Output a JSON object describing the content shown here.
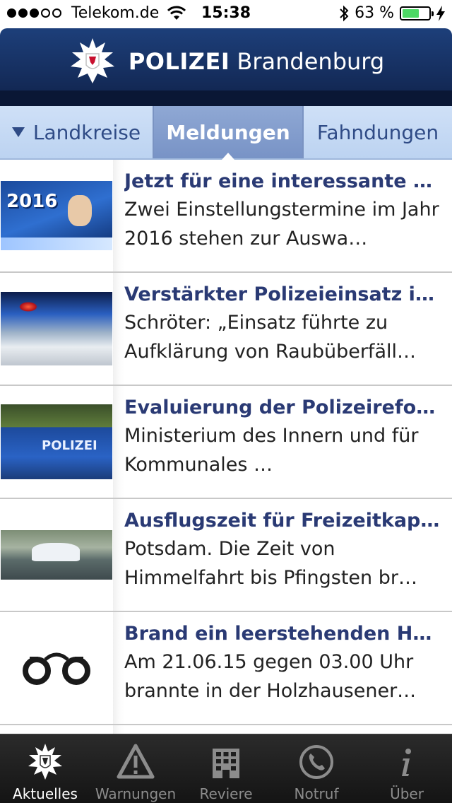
{
  "status_bar": {
    "signal": [
      true,
      true,
      true,
      false,
      false
    ],
    "carrier": "Telekom.de",
    "time": "15:38",
    "battery_text": "63 %",
    "battery_level": 0.63,
    "icons": [
      "wifi-icon",
      "bluetooth-icon",
      "battery-icon",
      "charging-bolt-icon"
    ]
  },
  "header": {
    "logo": "brandenburg-police-star-icon",
    "title_bold": "POLIZEI",
    "title_regular": " Brandenburg"
  },
  "tabs": {
    "landkreise": "Landkreise",
    "meldungen": "Meldungen",
    "fahndungen": "Fahndungen",
    "active": "meldungen"
  },
  "news": [
    {
      "title": "Jetzt für eine interessante un…",
      "desc": "Zwei Einstellungstermine im Jahr 2016 stehen zur Auswa…",
      "thumb_text": "2016"
    },
    {
      "title": "Verstärkter Polizeieinsatz in…",
      "desc": "Schröter: „Einsatz führte zu Aufklärung von Raubüberfäll…"
    },
    {
      "title": "Evaluierung der Polizeirefor…",
      "desc": "Ministerium des Innern und für Kommunales …",
      "thumb_text": "POLIZEI"
    },
    {
      "title": "Ausflugszeit für Freizeitkapit…",
      "desc": "Potsdam. Die Zeit von Himmelfahrt bis Pfingsten br…"
    },
    {
      "title": "Brand ein leerstehenden Hau…",
      "desc": "Am 21.06.15 gegen 03.00 Uhr brannte in der Holzhausener…",
      "icon": "handcuffs-icon"
    }
  ],
  "tabbar": {
    "items": [
      {
        "label": "Aktuelles",
        "icon": "police-star-icon",
        "active": true
      },
      {
        "label": "Warnungen",
        "icon": "warning-icon",
        "active": false
      },
      {
        "label": "Reviere",
        "icon": "building-icon",
        "active": false
      },
      {
        "label": "Notruf",
        "icon": "phone-icon",
        "active": false
      },
      {
        "label": "Über",
        "icon": "info-icon",
        "active": false
      }
    ]
  },
  "colors": {
    "header_blue": "#142b59",
    "tab_bg": "#cfe0f7",
    "tab_active": "#8fa8d4",
    "title_text": "#2a3a74",
    "battery_green": "#4cd964"
  }
}
